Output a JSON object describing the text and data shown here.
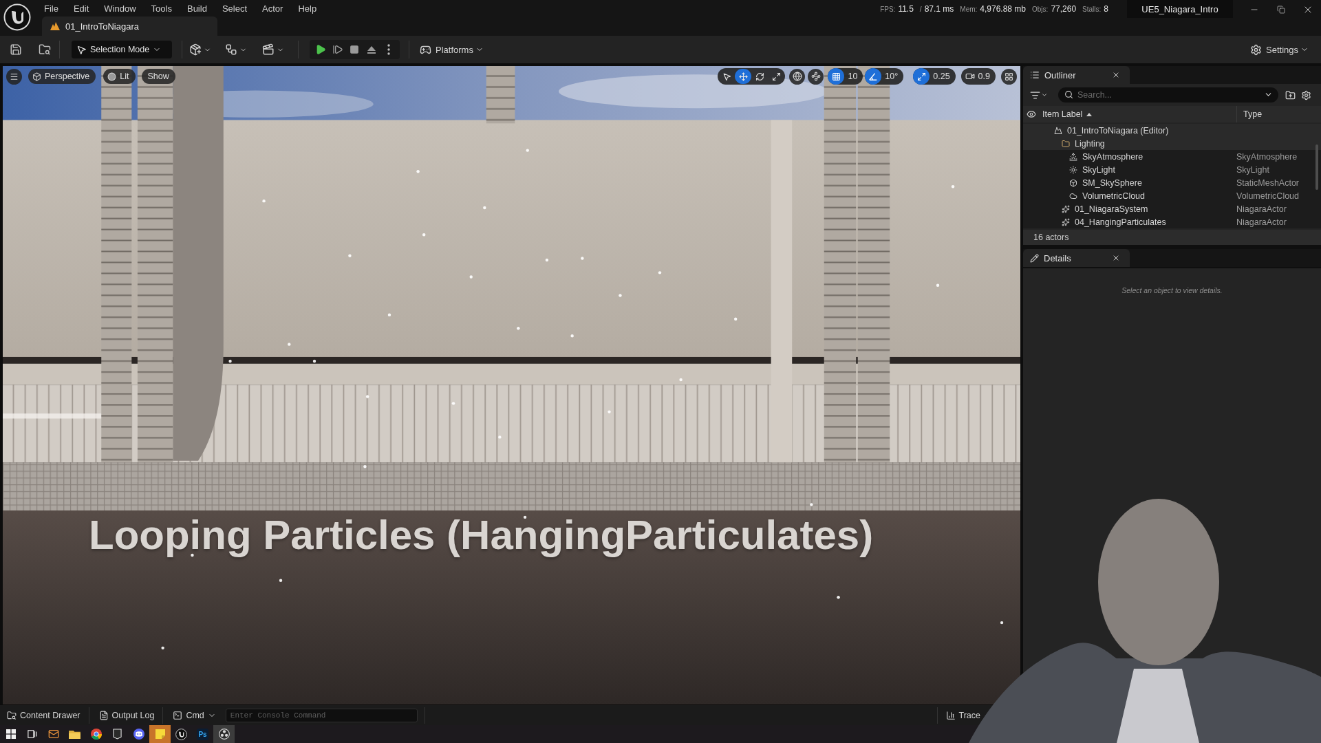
{
  "title_bar": {
    "menu": [
      "File",
      "Edit",
      "Window",
      "Tools",
      "Build",
      "Select",
      "Actor",
      "Help"
    ],
    "document_tab": "01_IntroToNiagara",
    "stats": [
      {
        "label": "FPS:",
        "value": "11.5"
      },
      {
        "label": "/",
        "value": "87.1 ms"
      },
      {
        "label": "Mem:",
        "value": "4,976.88 mb"
      },
      {
        "label": "Objs:",
        "value": "77,260"
      },
      {
        "label": "Stalls:",
        "value": "8"
      }
    ],
    "project": "UE5_Niagara_Intro"
  },
  "toolbar": {
    "mode_button": "Selection Mode",
    "platforms_button": "Platforms",
    "settings_button": "Settings"
  },
  "viewport": {
    "view_buttons": [
      {
        "kind": "perspective",
        "label": "Perspective"
      },
      {
        "kind": "lit",
        "label": "Lit"
      },
      {
        "kind": "show",
        "label": "Show"
      }
    ],
    "transform_tools": [
      {
        "kind": "select",
        "selected": false
      },
      {
        "kind": "move",
        "selected": true
      },
      {
        "kind": "rotate",
        "selected": false
      },
      {
        "kind": "scale",
        "selected": false
      }
    ],
    "snaps": [
      {
        "kind": "grid",
        "on": true,
        "value": "10"
      },
      {
        "kind": "angle",
        "on": true,
        "value": "10°"
      },
      {
        "kind": "scale",
        "on": true,
        "value": "0.25"
      }
    ],
    "camera_speed": "0.9",
    "caption": "Looping Particles (HangingParticulates)"
  },
  "outliner": {
    "title": "Outliner",
    "search": {
      "placeholder": "Search..."
    },
    "columns": [
      "Item Label",
      "Type"
    ],
    "items": [
      {
        "label": "01_IntroToNiagara (Editor)",
        "kind": "world",
        "children": [
          {
            "label": "Lighting",
            "kind": "folder",
            "children": [
              {
                "label": "SkyAtmosphere",
                "type": "SkyAtmosphere",
                "kind": "sky-atmosphere"
              },
              {
                "label": "SkyLight",
                "type": "SkyLight",
                "kind": "sky-light"
              },
              {
                "label": "SM_SkySphere",
                "type": "StaticMeshActor",
                "kind": "static-mesh"
              },
              {
                "label": "VolumetricCloud",
                "type": "VolumetricCloud",
                "kind": "cloud"
              }
            ]
          },
          {
            "label": "01_NiagaraSystem",
            "type": "NiagaraActor",
            "kind": "niagara"
          },
          {
            "label": "04_HangingParticulates",
            "type": "NiagaraActor",
            "kind": "niagara"
          }
        ]
      }
    ],
    "footer": "16 actors"
  },
  "details": {
    "title": "Details",
    "empty_message": "Select an object to view details."
  },
  "status_bar": {
    "buttons": [
      {
        "kind": "content-drawer",
        "label": "Content Drawer"
      },
      {
        "kind": "output-log",
        "label": "Output Log"
      }
    ],
    "cmd": "Cmd",
    "console": {
      "placeholder": "Enter Console Command"
    },
    "trace": "Trace"
  },
  "taskbar": {
    "apps": [
      {
        "kind": "start",
        "active": false,
        "attention": false
      },
      {
        "kind": "task-view",
        "active": false,
        "attention": false
      },
      {
        "kind": "mail",
        "active": false,
        "attention": false
      },
      {
        "kind": "files",
        "active": false,
        "attention": false
      },
      {
        "kind": "browser",
        "active": false,
        "attention": false
      },
      {
        "kind": "store",
        "active": false,
        "attention": false
      },
      {
        "kind": "chat",
        "active": false,
        "attention": false
      },
      {
        "kind": "notes",
        "active": false,
        "attention": true
      },
      {
        "kind": "engine",
        "active": false,
        "attention": false
      },
      {
        "kind": "photoshop",
        "label": "Ps",
        "active": false,
        "attention": false
      },
      {
        "kind": "recorder",
        "active": true,
        "attention": false
      }
    ]
  }
}
